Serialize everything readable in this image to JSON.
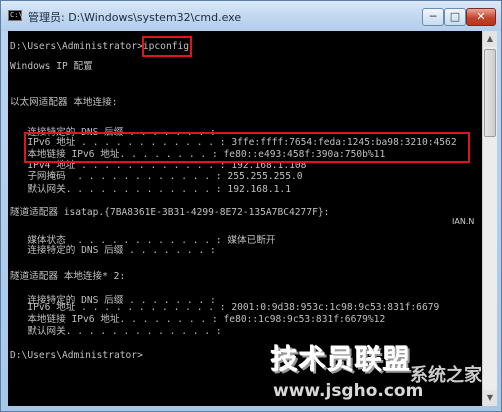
{
  "window": {
    "icon_text": "C:\\",
    "title": "管理员: D:\\Windows\\system32\\cmd.exe",
    "minimize": "─",
    "maximize": "□",
    "close": "✕"
  },
  "console_lines": [
    "D:\\Users\\Administrator>ipconfig",
    "",
    "Windows IP 配置",
    "",
    "",
    "以太网适配器 本地连接:",
    "",
    "   连接特定的 DNS 后缀 . . . . . . . :",
    "   IPv6 地址 . . . . . . . . . . . . : 3ffe:ffff:7654:feda:1245:ba98:3210:4562",
    "   本地链接 IPv6 地址. . . . . . . . : fe80::e493:458f:390a:750b%11",
    "   IPv4 地址 . . . . . . . . . . . . : 192.168.1.108",
    "   子网掩码  . . . . . . . . . . . . : 255.255.255.0",
    "   默认网关. . . . . . . . . . . . . : 192.168.1.1",
    "",
    "隧道适配器 isatap.{7BA8361E-3B31-4299-8E72-135A7BC4277F}:",
    "",
    "   媒体状态  . . . . . . . . . . . . : 媒体已断开",
    "   连接特定的 DNS 后缀 . . . . . . . :",
    "",
    "隧道适配器 本地连接* 2:",
    "",
    "   连接特定的 DNS 后缀 . . . . . . . :",
    "   IPv6 地址 . . . . . . . . . . . . : 2001:0:9d38:953c:1c98:9c53:831f:6679",
    "   本地链接 IPv6 地址. . . . . . . . : fe80::1c98:9c53:831f:6679%12",
    "   默认网关. . . . . . . . . . . . . :",
    "",
    "D:\\Users\\Administrator>"
  ],
  "scrollbar": {
    "up": "▲",
    "down": "▼"
  },
  "watermark": {
    "brand": "技术员联盟",
    "url": "www.jsgho.com",
    "secondary": "系统之家",
    "side": "IAN.N"
  },
  "colors": {
    "console_bg": "#000000",
    "console_text": "#c0c0c0",
    "highlight": "#e1141e"
  }
}
